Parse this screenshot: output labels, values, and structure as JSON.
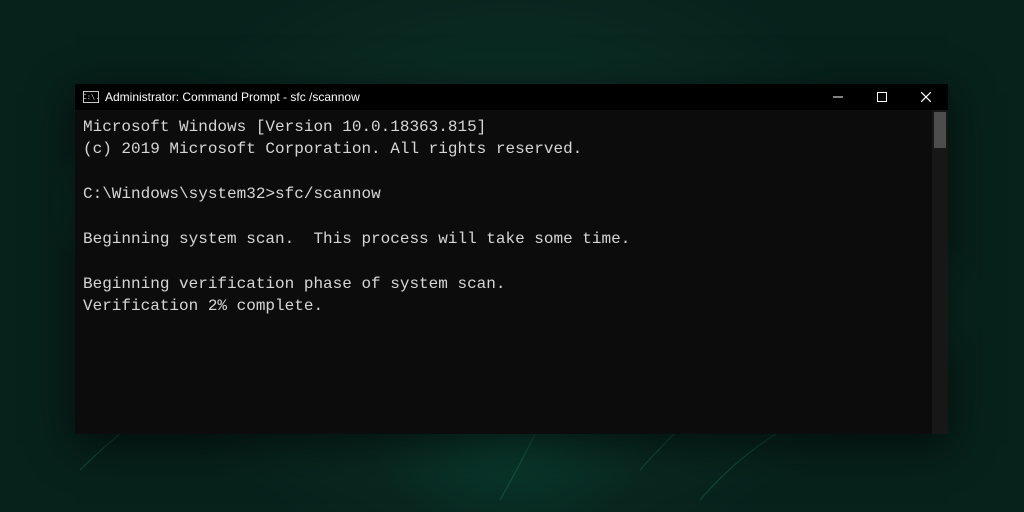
{
  "window": {
    "title": "Administrator: Command Prompt - sfc /scannow",
    "icon_glyph": "C:\\."
  },
  "terminal": {
    "header_version": "Microsoft Windows [Version 10.0.18363.815]",
    "header_copyright": "(c) 2019 Microsoft Corporation. All rights reserved.",
    "prompt_path": "C:\\Windows\\system32",
    "prompt_separator": ">",
    "command": "sfc/scannow",
    "line_begin_scan": "Beginning system scan.  This process will take some time.",
    "line_begin_verify": "Beginning verification phase of system scan.",
    "line_verify_progress": "Verification 2% complete."
  },
  "controls": {
    "minimize": "minimize",
    "maximize": "maximize",
    "close": "close"
  }
}
